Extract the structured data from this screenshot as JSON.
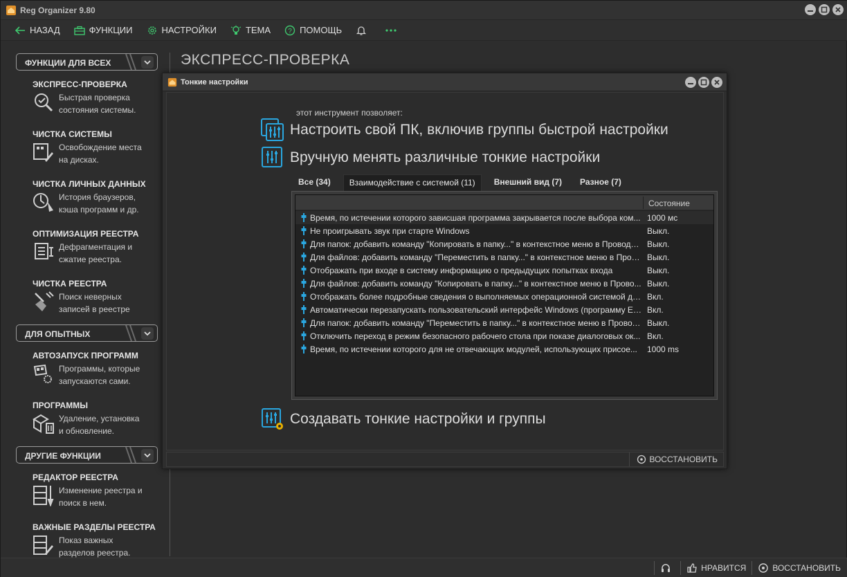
{
  "app": {
    "title": "Reg Organizer 9.80",
    "accent": "#f0a020"
  },
  "toolbar": {
    "back": "НАЗАД",
    "functions": "ФУНКЦИИ",
    "settings": "НАСТРОЙКИ",
    "theme": "ТЕМА",
    "help": "ПОМОЩЬ"
  },
  "sidebar": {
    "groups": [
      {
        "label": "ФУНКЦИИ ДЛЯ ВСЕХ"
      },
      {
        "label": "ДЛЯ ОПЫТНЫХ"
      },
      {
        "label": "ДРУГИЕ ФУНКЦИИ"
      }
    ],
    "items": [
      {
        "title": "ЭКСПРЕСС-ПРОВЕРКА",
        "desc1": "Быстрая проверка",
        "desc2": "состояния системы."
      },
      {
        "title": "ЧИСТКА СИСТЕМЫ",
        "desc1": "Освобождение места",
        "desc2": "на дисках."
      },
      {
        "title": "ЧИСТКА ЛИЧНЫХ ДАННЫХ",
        "desc1": "История браузеров,",
        "desc2": "кэша программ и др."
      },
      {
        "title": "ОПТИМИЗАЦИЯ РЕЕСТРА",
        "desc1": "Дефрагментация и",
        "desc2": "сжатие реестра."
      },
      {
        "title": "ЧИСТКА РЕЕСТРА",
        "desc1": "Поиск неверных",
        "desc2": "записей в реестре"
      },
      {
        "title": "АВТОЗАПУСК ПРОГРАММ",
        "desc1": "Программы, которые",
        "desc2": "запускаются сами."
      },
      {
        "title": "ПРОГРАММЫ",
        "desc1": "Удаление, установка",
        "desc2": "и обновление."
      },
      {
        "title": "РЕДАКТОР РЕЕСТРА",
        "desc1": "Изменение реестра и",
        "desc2": "поиск в нем."
      },
      {
        "title": "ВАЖНЫЕ РАЗДЕЛЫ РЕЕСТРА",
        "desc1": "Показ важных",
        "desc2": "разделов реестра."
      }
    ]
  },
  "main": {
    "title": "ЭКСПРЕСС-ПРОВЕРКА"
  },
  "dialog": {
    "title": "Тонкие настройки",
    "intro": "этот инструмент позволяет:",
    "feature1": "Настроить свой ПК, включив группы быстрой настройки",
    "feature2": "Вручную менять различные тонкие настройки",
    "feature3": "Создавать тонкие настройки и группы",
    "tabs": [
      {
        "label": "Все (34)"
      },
      {
        "label": "Взаимодействие с системой (11)"
      },
      {
        "label": "Внешний вид (7)"
      },
      {
        "label": "Разное (7)"
      }
    ],
    "column_state": "Состояние",
    "rows": [
      {
        "name": "Время, по истечении которого зависшая программа закрывается после выбора ком...",
        "value": "1000 мс"
      },
      {
        "name": "Не проигрывать звук при старте Windows",
        "value": "Выкл."
      },
      {
        "name": "Для папок: добавить команду \"Копировать в папку...\" в контекстное меню в Проводн...",
        "value": "Выкл."
      },
      {
        "name": "Для файлов: добавить команду \"Переместить в папку...\" в контекстное меню в Пров...",
        "value": "Выкл."
      },
      {
        "name": "Отображать при входе в систему информацию о предыдущих попытках входа",
        "value": "Выкл."
      },
      {
        "name": "Для файлов: добавить команду \"Копировать в папку...\" в контекстное меню в Прово...",
        "value": "Выкл."
      },
      {
        "name": "Отображать более подробные сведения о выполняемых операционной системой де...",
        "value": "Вкл."
      },
      {
        "name": "Автоматически перезапускать пользовательский интерфейс Windows (программу Ex...",
        "value": "Вкл."
      },
      {
        "name": "Для папок: добавить команду \"Переместить в папку...\" в контекстное меню в Провод...",
        "value": "Выкл."
      },
      {
        "name": "Отключить переход в режим безопасного рабочего стола при показе диалоговых ок...",
        "value": "Вкл."
      },
      {
        "name": "Время, по истечении которого для не отвечающих модулей, использующих присое...",
        "value": "1000 ms"
      }
    ],
    "restore": "ВОССТАНОВИТЬ"
  },
  "statusbar": {
    "like": "НРАВИТСЯ",
    "restore": "ВОССТАНОВИТЬ"
  }
}
